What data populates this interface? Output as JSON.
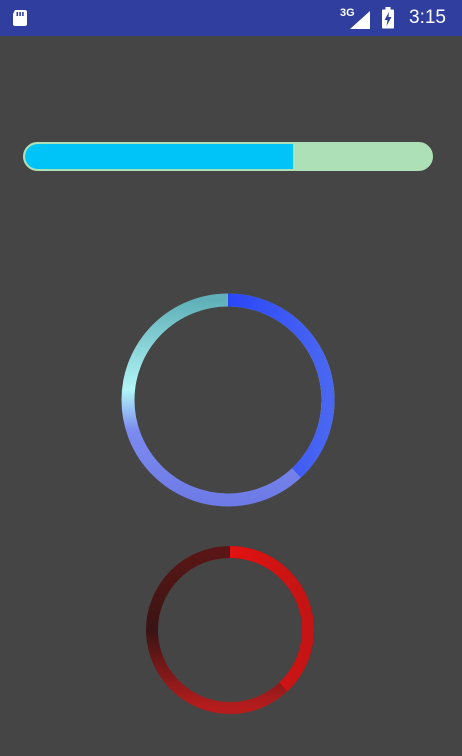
{
  "status_bar": {
    "background": "#303f9f",
    "network_type": "3G",
    "time": "3:15",
    "icons": [
      "sd-card-icon",
      "signal-icon",
      "battery-charging-icon"
    ]
  },
  "horizontal_progress": {
    "progress": 0.66,
    "fill_color": "#00c3f7",
    "track_color": "#aee0b7"
  },
  "circular_progress_blue": {
    "progress": 0.38,
    "progress_color": "#0a2cff",
    "track_gradient": [
      "#62b3bb",
      "#b0f4f6",
      "#6f7ce8"
    ]
  },
  "circular_progress_red": {
    "progress": 0.38,
    "progress_color": "#ff0f0f",
    "track_gradient": [
      "#3b1515",
      "#b81b1b"
    ]
  }
}
